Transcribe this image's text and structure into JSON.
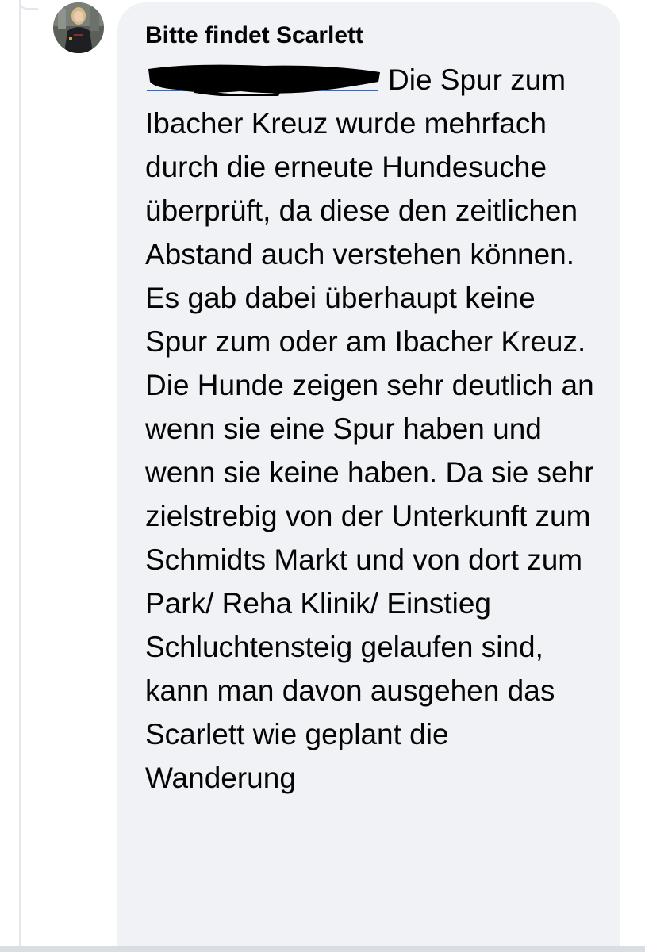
{
  "comment": {
    "author": "Bitte findet Scarlett",
    "avatar_icon": "profile-photo",
    "mention_state": "redacted",
    "text_after_mention": "Die Spur zum Ibacher Kreuz wurde mehrfach durch die erneute Hundesuche überprüft, da diese den zeitlichen Abstand auch verstehen können. Es gab dabei überhaupt keine Spur zum oder am Ibacher Kreuz. Die Hunde zeigen sehr deutlich an wenn sie eine Spur haben und wenn sie keine haben. Da sie sehr zielstrebig von der Unterkunft zum Schmidts Markt und von dort zum Park/ Reha Klinik/ Einstieg Schluchtensteig gelaufen sind, kann man davon ausgehen das Scarlett wie geplant die Wanderung"
  },
  "colors": {
    "bubble_bg": "#f0f2f5",
    "text": "#050505",
    "link": "#216fdb",
    "redaction": "#000000",
    "thread_line": "#e4e6eb"
  }
}
